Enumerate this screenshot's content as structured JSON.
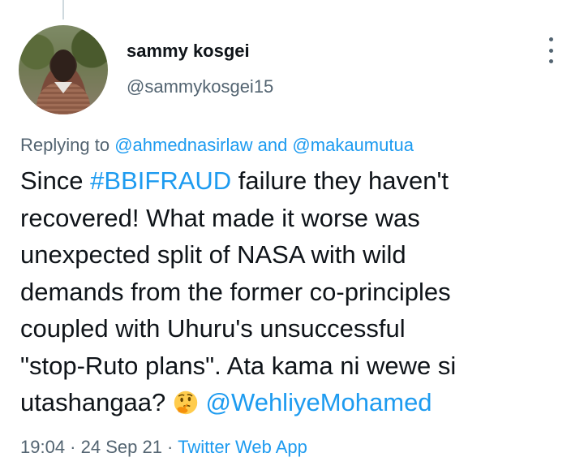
{
  "author": {
    "display_name": "sammy kosgei",
    "handle": "@sammykosgei15"
  },
  "reply": {
    "prefix": "Replying to ",
    "user1": "@ahmednasirlaw",
    "and": " and ",
    "user2": "@makaumutua"
  },
  "tweet": {
    "part1": "Since ",
    "hashtag": "#BBIFRAUD",
    "part2": " failure they haven't\nrecovered! What made it worse was\nunexpected split of NASA with wild\ndemands from the former co-principles\ncoupled with Uhuru's unsuccessful\n\"stop-Ruto plans\". Ata kama ni wewe si\nutashangaa? ",
    "emoji": "thinking-face-icon",
    "mention": "@WehliyeMohamed"
  },
  "meta": {
    "time": "19:04",
    "sep1": " · ",
    "date": "24 Sep 21",
    "sep2": " · ",
    "source": "Twitter Web App"
  },
  "colors": {
    "link": "#1d9bf0",
    "secondary_text": "#536471",
    "primary_text": "#0f1419"
  }
}
